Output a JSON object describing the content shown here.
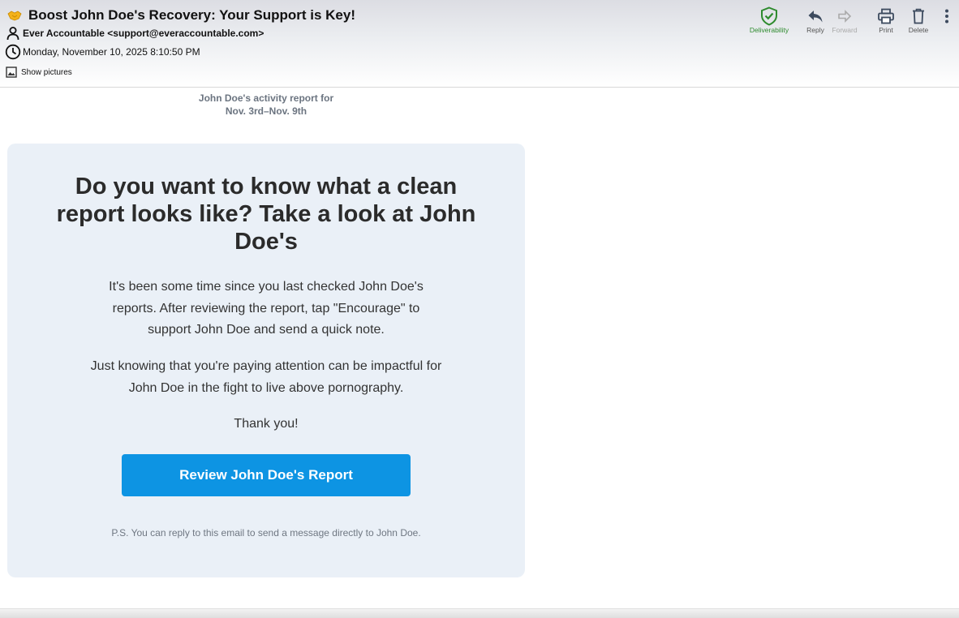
{
  "email": {
    "subject": "Boost John Doe's Recovery: Your Support is Key!",
    "subject_icon": "handshake-icon",
    "from": "Ever Accountable <support@everaccountable.com>",
    "date": "Monday, November 10, 2025 8:10:50 PM",
    "show_pictures_label": "Show pictures"
  },
  "toolbar": {
    "deliverability_label": "Deliverability",
    "reply_label": "Reply",
    "forward_label": "Forward",
    "print_label": "Print",
    "delete_label": "Delete"
  },
  "body": {
    "report_caption_line1": "John Doe's activity report for",
    "report_caption_line2": "Nov. 3rd–Nov. 9th",
    "headline": "Do you want to know what a clean report looks like? Take a look at John Doe's",
    "paragraph1": "It's been some time since you last checked John Doe's reports. After reviewing the report, tap \"Encourage\" to support John Doe and send a quick note.",
    "paragraph2": "Just knowing that you're paying attention can be impactful for John Doe in the fight to live above pornography.",
    "thank_you": "Thank you!",
    "cta_label": "Review John Doe's Report",
    "ps": "P.S. You can reply to this email to send a message directly to John Doe."
  },
  "colors": {
    "cta_background": "#0d94e3",
    "card_background": "#eaf0f7",
    "deliverability_green": "#2e8b2e"
  }
}
